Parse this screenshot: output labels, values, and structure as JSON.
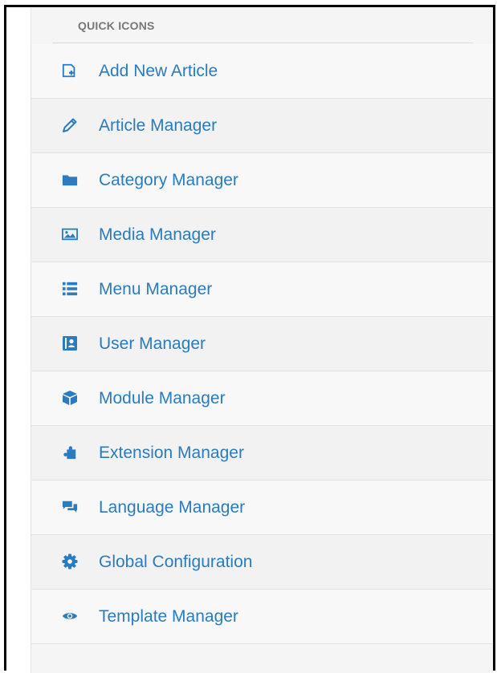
{
  "quick_icons": {
    "heading": "QUICK ICONS",
    "items": [
      {
        "label": "Add New Article",
        "icon": "new-article-icon"
      },
      {
        "label": "Article Manager",
        "icon": "pencil-icon"
      },
      {
        "label": "Category Manager",
        "icon": "folder-icon"
      },
      {
        "label": "Media Manager",
        "icon": "image-icon"
      },
      {
        "label": "Menu Manager",
        "icon": "list-icon"
      },
      {
        "label": "User Manager",
        "icon": "user-card-icon"
      },
      {
        "label": "Module Manager",
        "icon": "cube-icon"
      },
      {
        "label": "Extension Manager",
        "icon": "puzzle-icon"
      },
      {
        "label": "Language Manager",
        "icon": "chat-bubbles-icon"
      },
      {
        "label": "Global Configuration",
        "icon": "gear-icon"
      },
      {
        "label": "Template Manager",
        "icon": "eye-icon"
      }
    ]
  },
  "colors": {
    "link": "#2a7bbf",
    "heading": "#777777",
    "panel_bg": "#f5f5f5"
  }
}
